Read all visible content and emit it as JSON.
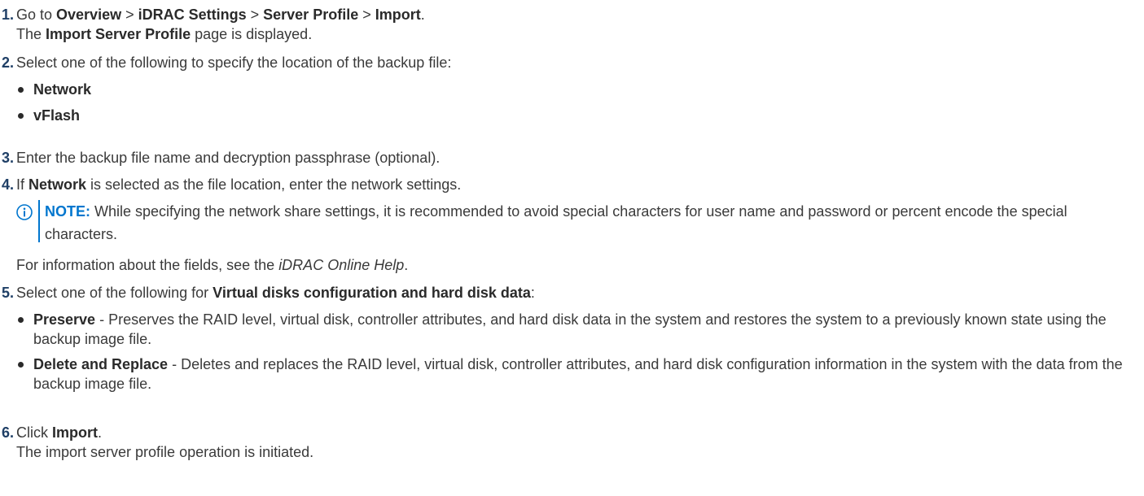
{
  "steps": {
    "s1": {
      "number": "1.",
      "go_to": "Go to ",
      "path": [
        "Overview",
        "iDRAC Settings",
        "Server Profile",
        "Import"
      ],
      "sep": " > ",
      "end": ".",
      "result_bold": "Import Server Profile",
      "result_rest": " page is displayed.",
      "result_prefix": "The "
    },
    "s2": {
      "number": "2.",
      "text": "Select one of the following to specify the location of the backup file:",
      "options": [
        "Network",
        "vFlash"
      ]
    },
    "s3": {
      "number": "3.",
      "text": "Enter the backup file name and decryption passphrase (optional)."
    },
    "s4": {
      "number": "4.",
      "prefix": "If ",
      "bold": "Network",
      "rest": " is selected as the file location, enter the network settings.",
      "note_label": "NOTE:",
      "note_text": " While specifying the network share settings, it is recommended to avoid special characters for user name and password or percent encode the special characters.",
      "info_prefix": "For information about the fields, see the ",
      "info_italic": "iDRAC Online Help",
      "info_end": "."
    },
    "s5": {
      "number": "5.",
      "prefix": "Select one of the following for ",
      "bold": "Virtual disks configuration and hard disk data",
      "end": ":",
      "options": [
        {
          "name": "Preserve",
          "desc": " - Preserves the RAID level, virtual disk, controller attributes, and hard disk data in the system and restores the system to a previously known state using the backup image file."
        },
        {
          "name": "Delete and Replace",
          "desc": " - Deletes and replaces the RAID level, virtual disk, controller attributes, and hard disk configuration information in the system with the data from the backup image file."
        }
      ]
    },
    "s6": {
      "number": "6.",
      "prefix": "Click ",
      "bold": "Import",
      "end": ".",
      "result": "The import server profile operation is initiated."
    }
  },
  "icons": {
    "note": "info-circle-icon"
  },
  "colors": {
    "number": "#1f3f66",
    "note_accent": "#0076ce",
    "text": "#3a3a3a"
  }
}
